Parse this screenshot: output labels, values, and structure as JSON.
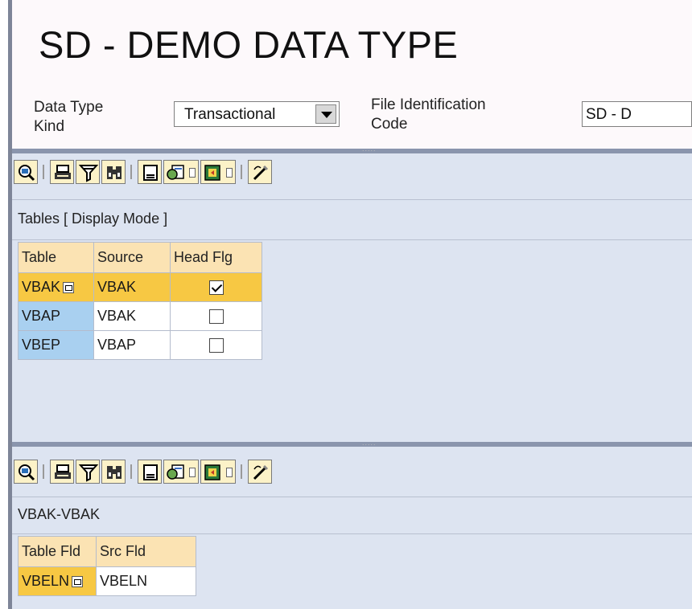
{
  "header": {
    "title": "SD - DEMO DATA TYPE",
    "data_type_kind_label_1": "Data Type",
    "data_type_kind_label_2": "Kind",
    "data_type_kind_value": "Transactional",
    "file_id_label_1": "File Identification",
    "file_id_label_2": "Code",
    "file_id_value": "SD - D"
  },
  "toolbar": {
    "buttons": [
      "details-icon",
      "print-icon",
      "filter-icon",
      "find-icon",
      "print-preview-icon",
      "export-icon",
      "layout-icon",
      "change-layout-icon"
    ]
  },
  "tables_panel": {
    "title": "Tables [ Display Mode ]",
    "columns": [
      "Table",
      "Source",
      "Head Flg"
    ],
    "rows": [
      {
        "table": "VBAK",
        "source": "VBAK",
        "head_flag": true,
        "selected": true
      },
      {
        "table": "VBAP",
        "source": "VBAK",
        "head_flag": false,
        "selected": false
      },
      {
        "table": "VBEP",
        "source": "VBAP",
        "head_flag": false,
        "selected": false
      }
    ]
  },
  "fields_panel": {
    "title": "VBAK-VBAK",
    "columns": [
      "Table Fld",
      "Src Fld"
    ],
    "rows": [
      {
        "table_fld": "VBELN",
        "src_fld": "VBELN"
      }
    ]
  },
  "colors": {
    "selected_row": "#f7c843",
    "key_cell": "#a9d0f0",
    "header_cell": "#fbe3b3",
    "panel_bg": "#dde4f1",
    "splitter": "#8a95ad"
  }
}
